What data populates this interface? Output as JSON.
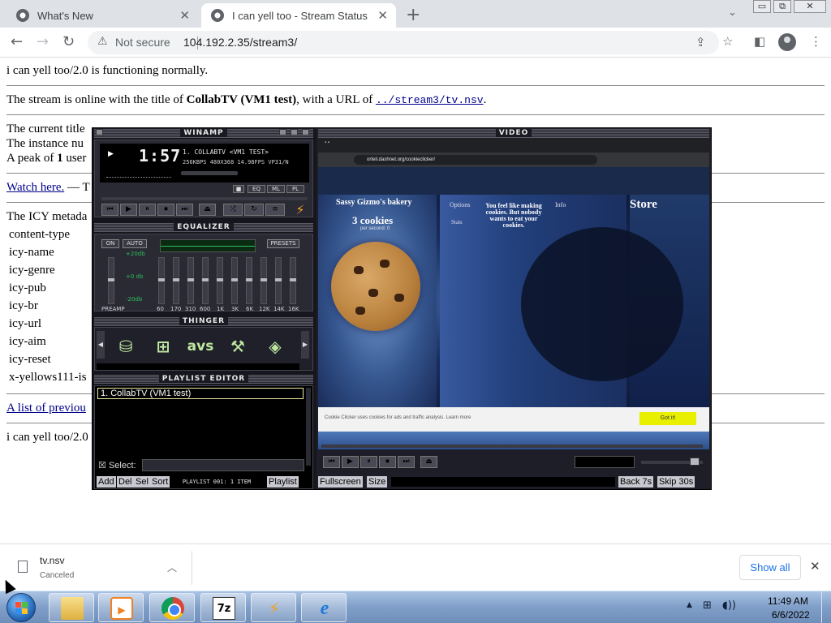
{
  "browser": {
    "tabs": [
      {
        "title": "What's New",
        "icon": "chrome-page-icon",
        "active": false
      },
      {
        "title": "I can yell too - Stream Status",
        "icon": "chrome-page-icon",
        "active": true
      }
    ],
    "new_tab": "+",
    "tab_menu": "⌄",
    "window_controls": {
      "minimize": "▭",
      "restore": "⧉",
      "close": "✕"
    },
    "security_label": "Not secure",
    "url": "104.192.2.35/stream3/"
  },
  "page": {
    "status_line": "i can yell too/2.0 is functioning normally.",
    "stream_prefix": "The stream is online with the title of ",
    "stream_title": "CollabTV (VM1 test)",
    "stream_mid": ", with a URL of ",
    "stream_url": "../stream3/tv.nsv",
    "stream_suffix": ".",
    "current_title_partial": "The current title",
    "instance_partial": "The instance nu",
    "peak_prefix": "A peak of ",
    "peak_value": "1",
    "peak_suffix": " user",
    "watch_link": "Watch here.",
    "watch_suffix": " — T",
    "icy_meta_partial": "The ICY metada",
    "metadata_keys": [
      "content-type",
      "icy-name",
      "icy-genre",
      "icy-pub",
      "icy-br",
      "icy-url",
      "icy-aim",
      "icy-reset",
      "x-yellows111-is"
    ],
    "previous_link_partial": "A list of previou",
    "footer_partial": "i can yell too/2.0"
  },
  "winamp": {
    "main_title": "WINAMP",
    "clock": "1:57",
    "song_title": "1. COLLABTV <VM1 TEST>",
    "song_info": "256KBPS 480X368 14.98FPS VP31/N",
    "toggles": [
      "EQ",
      "ML",
      "PL"
    ],
    "transport": [
      "⏮",
      "▶",
      "⏸",
      "⏹",
      "⏭",
      "⏏"
    ],
    "equalizer_title": "EQUALIZER",
    "eq_on": "ON",
    "eq_auto": "AUTO",
    "eq_presets": "PRESETS",
    "eq_db": [
      "+20db",
      "+0 db",
      "-20db"
    ],
    "eq_preamp": "PREAMP",
    "eq_bands": [
      "60",
      "170",
      "310",
      "600",
      "1K",
      "3K",
      "6K",
      "12K",
      "14K",
      "16K"
    ],
    "thinger_title": "THINGER",
    "thinger_icons": [
      "⛁",
      "⊞",
      "avs",
      "⚒",
      "◈"
    ],
    "playlist_title": "PLAYLIST EDITOR",
    "playlist_item": "1.  CollabTV (VM1 test)",
    "select_label": "Select:",
    "playlist_buttons": [
      "Add",
      "Del",
      "Sel",
      "Sort"
    ],
    "playlist_info": "PLAYLIST 001: 1 ITEM",
    "playlist_menu": "Playlist",
    "video_title": "VIDEO",
    "video_buttons": {
      "fullscreen": "Fullscreen",
      "size": "Size",
      "back": "Back 7s",
      "skip": "Skip 30s"
    }
  },
  "video_content": {
    "url": "orteil.dashnet.org/cookieclicker/",
    "bakery": "Sassy Gizmo's bakery",
    "cookies": "3 cookies",
    "per_second": "per second: 0",
    "tagline": "You feel like making cookies. But nobody wants to eat your cookies.",
    "store": "Store",
    "info": "Info",
    "options": "Options",
    "stats": "Stats",
    "banner": "Cookie Clicker uses cookies for ads and traffic analysis. Learn more",
    "got_it": "Got it!"
  },
  "downloads": {
    "file_name": "tv.nsv",
    "status": "Canceled",
    "show_all": "Show all"
  },
  "taskbar": {
    "time": "11:49 AM",
    "date": "6/6/2022"
  }
}
